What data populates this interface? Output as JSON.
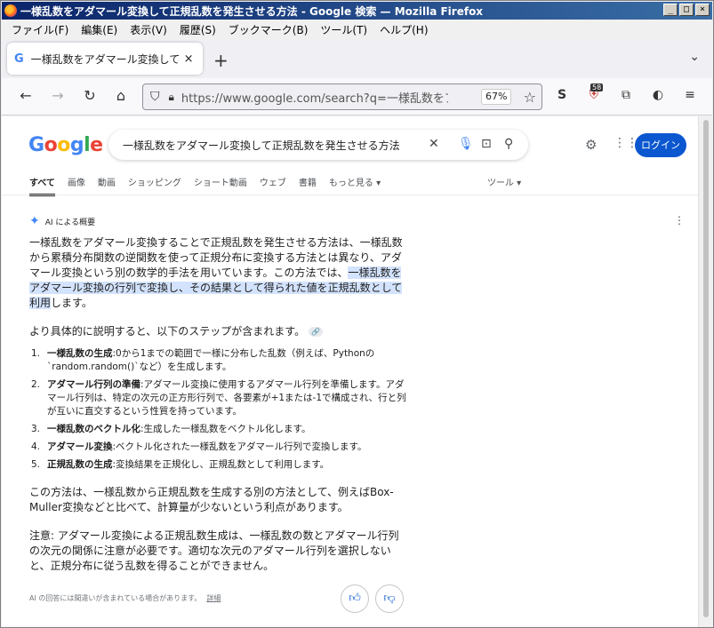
{
  "window": {
    "title": "一様乱数をアダマール変換して正規乱数を発生させる方法 - Google 検索 — Mozilla Firefox",
    "min_label": "_",
    "max_label": "□",
    "close_label": "×"
  },
  "menu": [
    "ファイル(F)",
    "編集(E)",
    "表示(V)",
    "履歴(S)",
    "ブックマーク(B)",
    "ツール(T)",
    "ヘルプ(H)"
  ],
  "tab": {
    "favicon": "G",
    "title": "一様乱数をアダマール変換して正規乱数",
    "close": "×",
    "new_tab": "+",
    "list_all": "⌄"
  },
  "nav": {
    "url": "https://www.google.com/search?q=一様乱数をアダマ",
    "zoom": "67%",
    "ext_badge": "58"
  },
  "google": {
    "logo": [
      "G",
      "o",
      "o",
      "g",
      "l",
      "e"
    ],
    "logo_colors": [
      "#4285f4",
      "#ea4335",
      "#fbbc05",
      "#4285f4",
      "#34a853",
      "#ea4335"
    ],
    "query": "一様乱数をアダマール変換して正規乱数を発生させる方法",
    "login": "ログイン",
    "tabs": [
      "すべて",
      "画像",
      "動画",
      "ショッピング",
      "ショート動画",
      "ウェブ",
      "書籍",
      "もっと見る ▾"
    ],
    "tools": "ツール ▾"
  },
  "ai": {
    "label": "AI による概要",
    "p1_before": "一様乱数をアダマール変換することで正規乱数を発生させる方法は、一様乱数から累積分布関数の逆関数を使って正規分布に変換する方法とは異なり、アダマール変換という別の数学的手法を用いています。この方法では、",
    "p1_highlight": "一様乱数をアダマール変換の行列で変換し、その結果として得られた値を正規乱数として利用",
    "p1_after": "します。",
    "p2": "より具体的に説明すると、以下のステップが含まれます。",
    "link_chip": "🔗",
    "steps": [
      {
        "num": "1.",
        "title": "一様乱数の生成",
        "text": ":0から1までの範囲で一様に分布した乱数（例えば、Pythonの`random.random()`など）を生成します。"
      },
      {
        "num": "2.",
        "title": "アダマール行列の準備",
        "text": ":アダマール変換に使用するアダマール行列を準備します。アダマール行列は、特定の次元の正方形行列で、各要素が+1または-1で構成され、行と列が互いに直交するという性質を持っています。"
      },
      {
        "num": "3.",
        "title": "一様乱数のベクトル化",
        "text": ":生成した一様乱数をベクトル化します。"
      },
      {
        "num": "4.",
        "title": "アダマール変換",
        "text": ":ベクトル化された一様乱数をアダマール行列で変換します。"
      },
      {
        "num": "5.",
        "title": "正規乱数の生成",
        "text": ":変換結果を正規化し、正規乱数として利用します。"
      }
    ],
    "p3": "この方法は、一様乱数から正規乱数を生成する別の方法として、例えばBox-Muller変換などと比べて、計算量が少ないという利点があります。",
    "p4": "注意: アダマール変換による正規乱数生成は、一様乱数の数とアダマール行列の次元の関係に注意が必要です。適切な次元のアダマール行列を選択しないと、正規分布に従う乱数を得ることができません。",
    "disclaimer": "AI の回答には間違いが含まれている場合があります。",
    "details": "詳細"
  }
}
